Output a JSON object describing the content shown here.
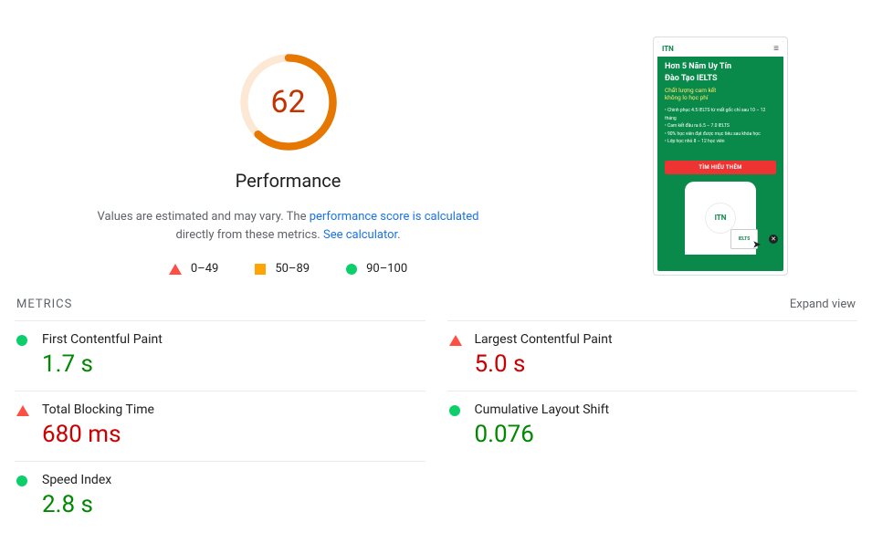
{
  "score": {
    "value": "62",
    "title": "Performance",
    "desc_prefix": "Values are estimated and may vary. The ",
    "link1": "performance score is calculated",
    "desc_mid": " directly from these metrics. ",
    "link2": "See calculator",
    "desc_suffix": "."
  },
  "legend": {
    "fail": "0–49",
    "avg": "50–89",
    "pass": "90–100"
  },
  "preview": {
    "brand": "ITN",
    "heading_l1": "Hơn 5 Năm Uy Tín",
    "heading_l2": "Đào Tạo IELTS",
    "sub_l1": "Chất lượng cam kết",
    "sub_l2": "không lo học phí",
    "bullets": [
      "Chinh phục 4.5 IELTS từ mất gốc chỉ sau 10 – 12 tháng",
      "Cam kết đầu ra 6.5 – 7.0 IELTS",
      "90% học viên đạt được mục tiêu sau khóa học",
      "Lớp học nhỏ 8 – 12 học viên"
    ],
    "cta": "TÌM HIỂU THÊM",
    "badge": "IELTS"
  },
  "metrics": {
    "section_title": "METRICS",
    "expand": "Expand view",
    "items": [
      {
        "label": "First Contentful Paint",
        "value": "1.7 s",
        "status": "pass"
      },
      {
        "label": "Largest Contentful Paint",
        "value": "5.0 s",
        "status": "fail"
      },
      {
        "label": "Total Blocking Time",
        "value": "680 ms",
        "status": "fail"
      },
      {
        "label": "Cumulative Layout Shift",
        "value": "0.076",
        "status": "pass"
      },
      {
        "label": "Speed Index",
        "value": "2.8 s",
        "status": "pass"
      }
    ]
  },
  "colors": {
    "pass": "#0cce6b",
    "avg": "#ffa400",
    "fail": "#ff4e42"
  },
  "chart_data": {
    "type": "gauge",
    "value": 62,
    "min": 0,
    "max": 100,
    "bands": [
      {
        "label": "0–49",
        "color": "#ff4e42"
      },
      {
        "label": "50–89",
        "color": "#ffa400"
      },
      {
        "label": "90–100",
        "color": "#0cce6b"
      }
    ]
  }
}
